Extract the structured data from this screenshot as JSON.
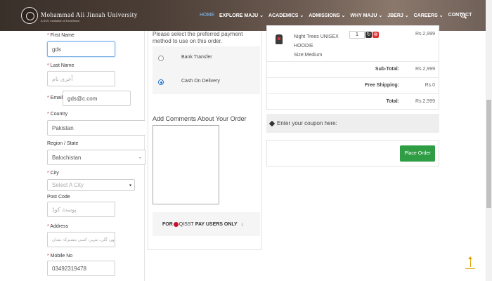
{
  "header": {
    "brand": "Mohammad Ali Jinnah University",
    "brand_sub": "A SOC Institution of Excellence",
    "nav": [
      "HOME",
      "EXPLORE MAJU ⌄",
      "ACADEMICS ⌄",
      "ADMISSIONS ⌄",
      "WHY MAJU ⌄",
      "JBERJ ⌄",
      "CAREERS ⌄",
      "CONTACT"
    ],
    "active_nav": "HOME",
    "search_icon": "search-icon"
  },
  "form": {
    "first_name": {
      "label": "First Name",
      "value": "gds"
    },
    "last_name": {
      "label": "Last Name",
      "placeholder": "آخری نام"
    },
    "email": {
      "label": "Email",
      "value": "gds@c.com"
    },
    "country": {
      "label": "Country",
      "value": "Pakistan"
    },
    "region": {
      "label": "Region / State",
      "value": "Balochistan"
    },
    "city": {
      "label": "City",
      "placeholder": "Select A City"
    },
    "post_code": {
      "label": "Post Code",
      "placeholder": "پوسٹ کوڈ"
    },
    "address": {
      "label": "Address",
      "placeholder": "گھر، گلی، شہر، کسی مشترکہ نشان"
    },
    "mobile": {
      "label": "Mobile No",
      "value": "03492319478"
    }
  },
  "payment": {
    "heading": "Please select the preferred payment method to use on this order.",
    "options": [
      "Bank Transfer",
      "Cash On Delivery"
    ],
    "selected": "Cash On Delivery"
  },
  "comments": {
    "title": "Add Comments About Your Order"
  },
  "qisst": {
    "prefix": "FOR",
    "brand": "QISST",
    "suffix": "PAY USERS ONLY",
    "arrow": "↓"
  },
  "cart": {
    "product": {
      "name": "Night Trees UNISEX",
      "line2": "HOODIE",
      "size": "Size:Medium",
      "qty": "1",
      "price": "Rs.2,999"
    },
    "subtotal": {
      "label": "Sub-Total:",
      "value": "Rs.2,999"
    },
    "shipping": {
      "label": "Free Shipping:",
      "value": "Rs.0"
    },
    "total": {
      "label": "Total:",
      "value": "Rs.2,999"
    }
  },
  "coupon": {
    "label": "Enter your coupon here:"
  },
  "order": {
    "button": "Place Order"
  },
  "colors": {
    "accent_green": "#2e9d44",
    "required": "#d12a2a",
    "active_nav": "#7ec3ff"
  }
}
